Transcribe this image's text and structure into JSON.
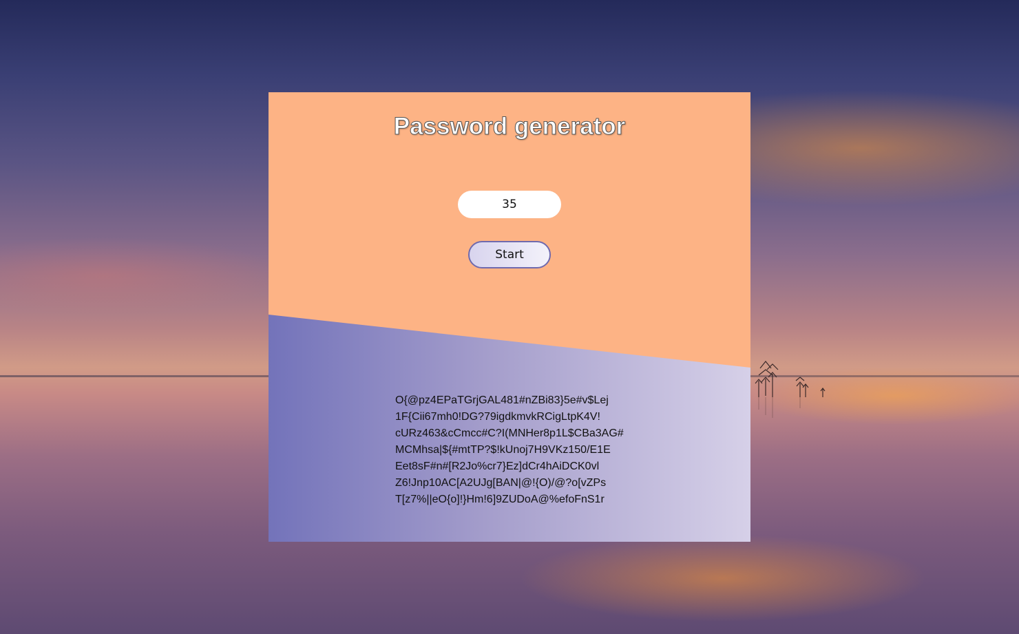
{
  "app": {
    "title": "Password generator"
  },
  "form": {
    "length_value": "35",
    "start_label": "Start"
  },
  "output": {
    "lines": [
      "O{@pz4EPaTGrjGAL481#nZBi83}5e#v$Lej",
      "1F{Cii67mh0!DG?79igdkmvkRCigLtpK4V!",
      "cURz463&cCmcc#C?I(MNHer8p1L$CBa3AG#",
      "MCMhsa|${#mtTP?$!kUnoj7H9VKz150/E1E",
      "Eet8sF#n#[R2Jo%cr7}Ez]dCr4hAiDCK0vl",
      "Z6!Jnp10AC[A2UJg[BAN|@!{O)/@?o[vZPs",
      "T[z7%||eO{o]!}Hm!6]9ZUDoA@%efoFnS1r"
    ]
  },
  "colors": {
    "card_top": "#fdb385",
    "card_bottom_start": "#7373ba",
    "card_bottom_end": "#d6d0e8",
    "button_border": "#6f6aae"
  }
}
